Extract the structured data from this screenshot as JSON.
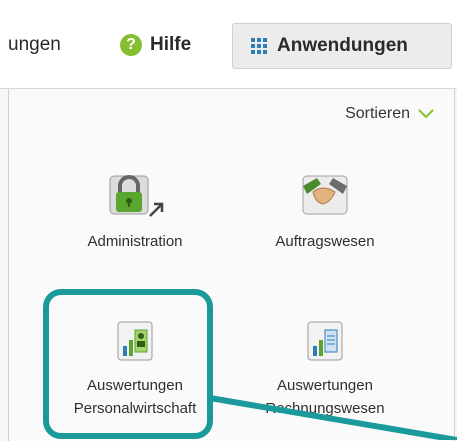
{
  "topbar": {
    "partial_nav_label": "ungen",
    "help_label": "Hilfe",
    "apps_label": "Anwendungen"
  },
  "panel": {
    "sort_label": "Sortieren",
    "tiles": [
      {
        "lines": [
          "Administration"
        ],
        "icon": "lock-icon"
      },
      {
        "lines": [
          "Auftragswesen"
        ],
        "icon": "handshake-icon"
      },
      {
        "lines": [
          "Auswertungen",
          "Personalwirtschaft"
        ],
        "icon": "chart-person-icon"
      },
      {
        "lines": [
          "Auswertungen",
          "Rechnungswesen"
        ],
        "icon": "chart-ledger-icon"
      }
    ]
  },
  "colors": {
    "accent_teal": "#1a9a9a",
    "help_green": "#86be32",
    "grid_blue": "#2d7fb8"
  }
}
